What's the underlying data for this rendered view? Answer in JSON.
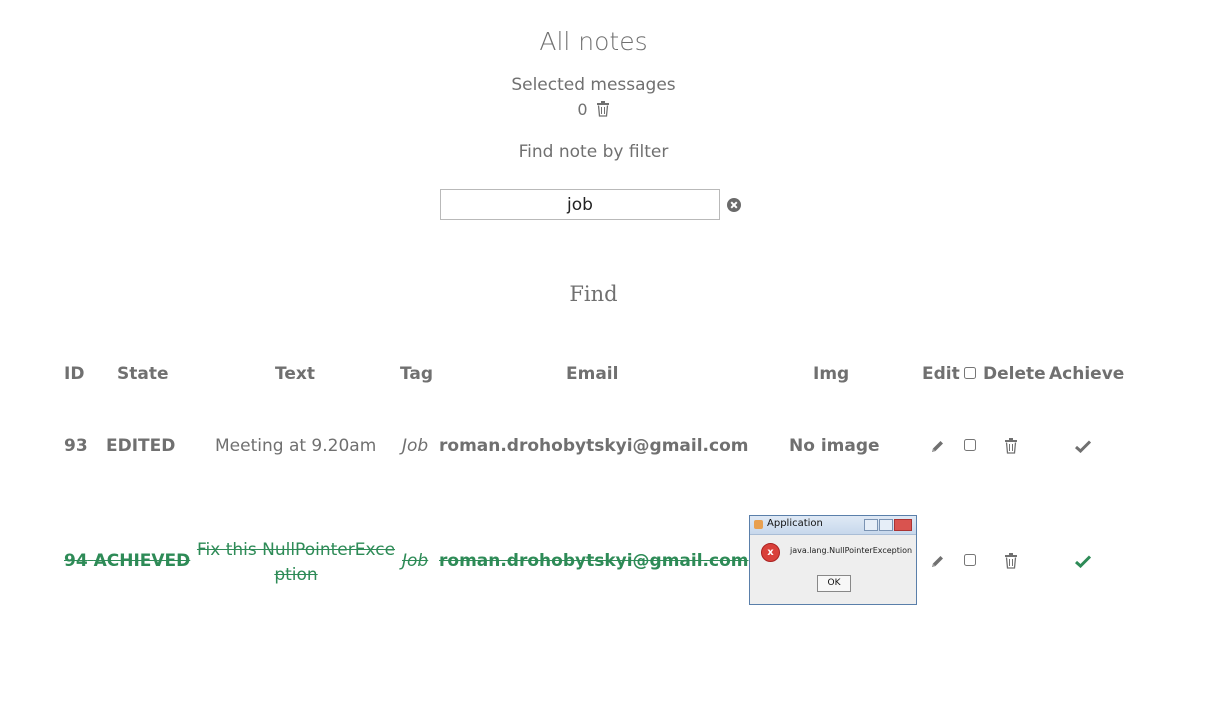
{
  "header": {
    "title": "All notes",
    "selected_label": "Selected messages",
    "selected_count": "0",
    "filter_label": "Find note by filter"
  },
  "search": {
    "value": "job",
    "placeholder": ""
  },
  "find_heading": "Find",
  "table": {
    "columns": [
      "ID",
      "State",
      "Text",
      "Tag",
      "Email",
      "Img",
      "Edit",
      "Delete",
      "Achieve"
    ],
    "rows": [
      {
        "id": "93",
        "state": "EDITED",
        "text": "Meeting at 9.20am",
        "tag": "Job",
        "email": "roman.drohobytskyi@gmail.com",
        "img": "No image",
        "achieved": false
      },
      {
        "id": "94",
        "state": "ACHIEVED",
        "text_line1": "Fix this NullPointerExce",
        "text_line2": "ption",
        "tag": "Job",
        "email": "roman.drohobytskyi@gmail.com",
        "img_window_title": "Application",
        "img_message": "java.lang.NullPointerException",
        "img_ok_label": "OK",
        "achieved": true
      }
    ]
  },
  "colors": {
    "text": "#707070",
    "achieved": "#2e8b57"
  },
  "icons": [
    "trash-icon",
    "clear-circle-icon",
    "pencil-icon",
    "check-icon"
  ]
}
